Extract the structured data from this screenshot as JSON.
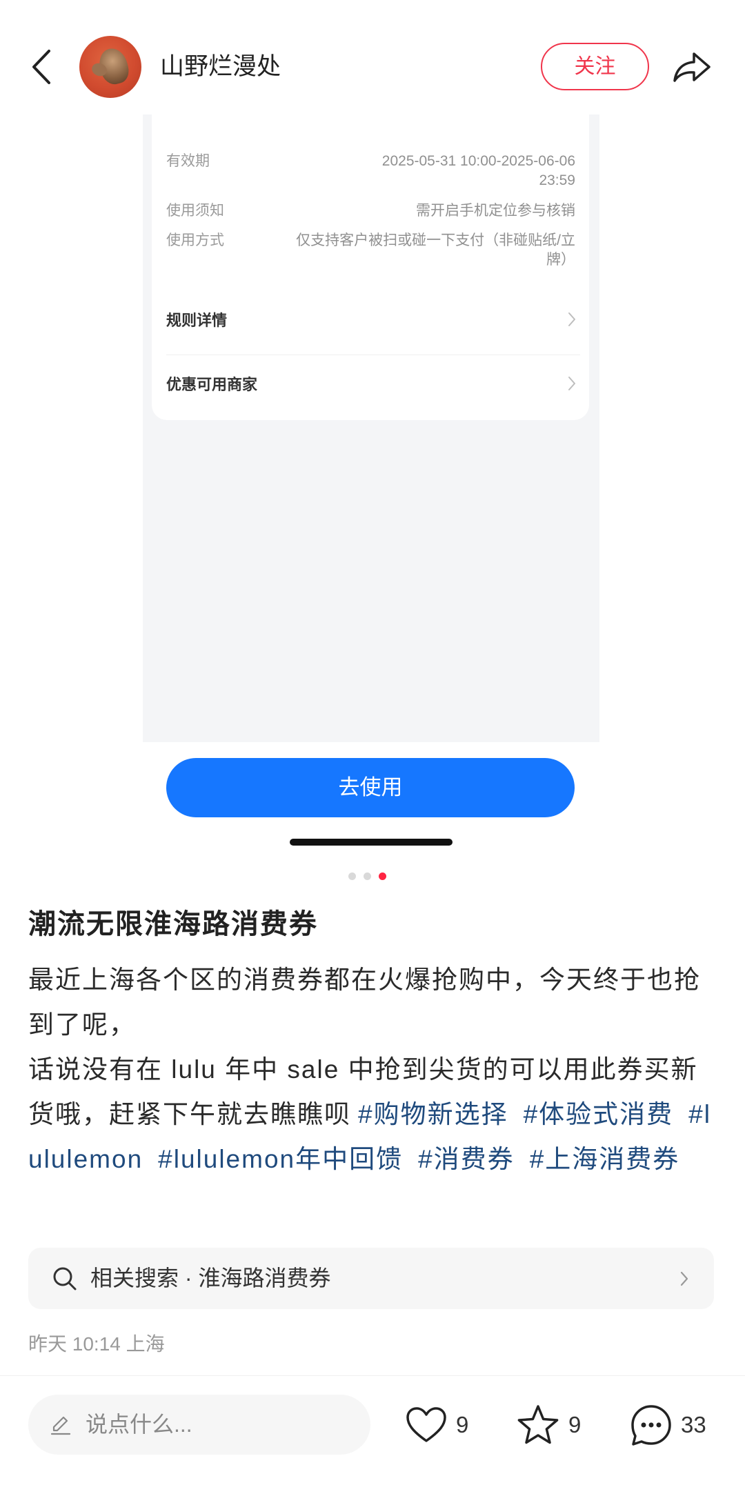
{
  "header": {
    "back_icon": "back-arrow-icon",
    "author_name": "山野烂漫处",
    "follow_label": "关注",
    "share_icon": "share-icon"
  },
  "carousel": {
    "image_count": 3,
    "active_image": 3,
    "screenshot": {
      "details": [
        {
          "label": "有效期",
          "value": "2025-05-31 10:00-2025-06-06 23:59"
        },
        {
          "label": "使用须知",
          "value": "需开启手机定位参与核销"
        },
        {
          "label": "使用方式",
          "value": "仅支持客户被扫或碰一下支付（非碰贴纸/立牌）"
        }
      ],
      "links": [
        {
          "label": "规则详情",
          "icon": "chevron-right-icon"
        },
        {
          "label": "优惠可用商家",
          "icon": "chevron-right-icon"
        }
      ],
      "use_button_label": "去使用"
    }
  },
  "note": {
    "title": "潮流无限淮海路消费券",
    "paragraph_1": "最近上海各个区的消费券都在火爆抢购中，今天终于也抢到了呢，",
    "paragraph_2": "话说没有在 lulu 年中 sale 中抢到尖货的可以用此券买新货哦，赶紧下午就去瞧瞧呗",
    "hashtags": [
      "#购物新选择",
      "#体验式消费",
      "#lululemon",
      "#lululemon年中回馈",
      "#消费券",
      "#上海消费券"
    ],
    "related_search": {
      "icon": "search-icon",
      "label": "相关搜索 · 淮海路消费券"
    },
    "meta": "昨天 10:14 上海"
  },
  "footer": {
    "comment_placeholder": "说点什么...",
    "comment_icon": "pencil-icon",
    "likes": "9",
    "collects": "9",
    "comments": "33"
  },
  "colors": {
    "accent": "#ff2442",
    "use_button": "#1677ff",
    "hashtag": "#1f4a7d",
    "screenshot_background": "#f4f5f7"
  }
}
